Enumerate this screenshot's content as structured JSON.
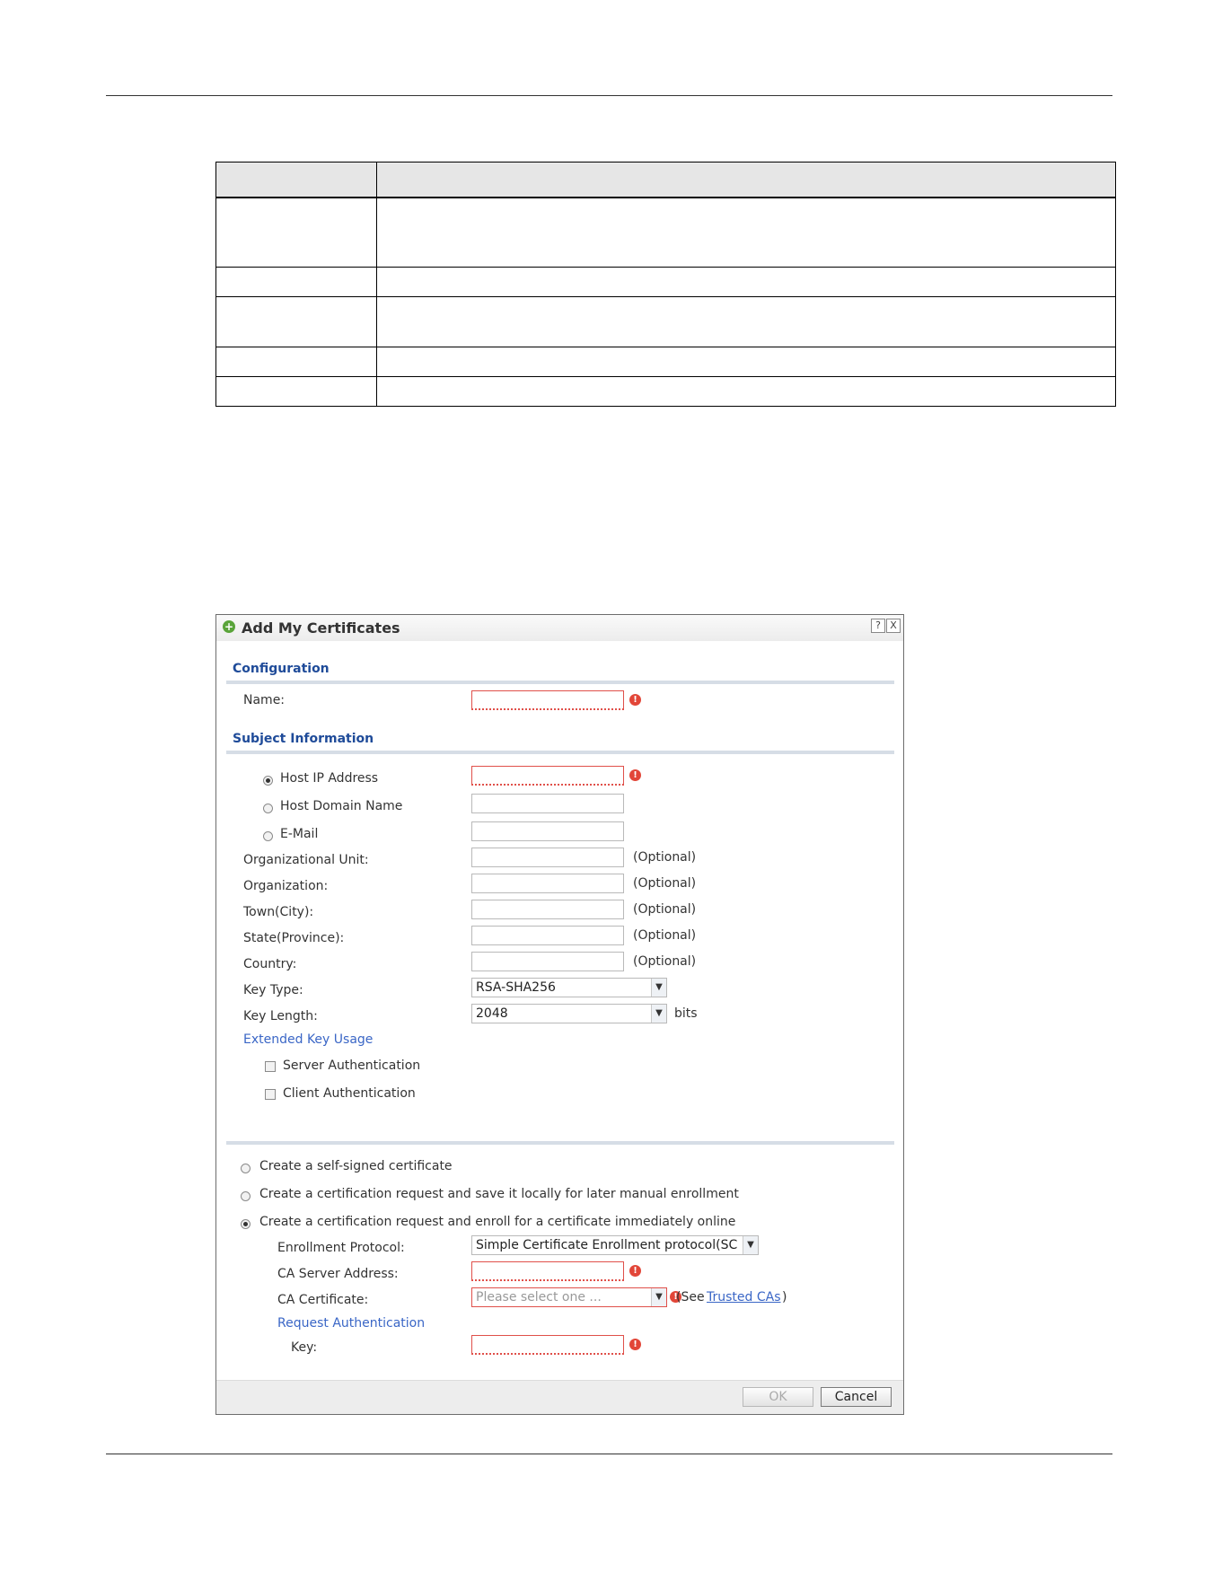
{
  "dialog": {
    "title": "Add My Certificates",
    "help_label": "?",
    "close_label": "X",
    "configuration": {
      "section_title": "Configuration",
      "name_label": "Name:"
    },
    "subject": {
      "section_title": "Subject Information",
      "host_ip_label": "Host IP Address",
      "host_domain_label": "Host Domain Name",
      "email_label": "E-Mail",
      "org_unit_label": "Organizational Unit:",
      "organization_label": "Organization:",
      "town_label": "Town(City):",
      "state_label": "State(Province):",
      "country_label": "Country:",
      "optional_label": "(Optional)",
      "key_type_label": "Key Type:",
      "key_type_value": "RSA-SHA256",
      "key_length_label": "Key Length:",
      "key_length_value": "2048",
      "bits_label": "bits",
      "eku_label": "Extended Key Usage",
      "server_auth_label": "Server Authentication",
      "client_auth_label": "Client Authentication"
    },
    "generation": {
      "self_signed_label": "Create a self-signed certificate",
      "request_save_label": "Create a certification request and save it locally for later manual enrollment",
      "request_enroll_label": "Create a certification request and enroll for a certificate immediately online",
      "enrollment_protocol_label": "Enrollment Protocol:",
      "enrollment_protocol_value": "Simple Certificate Enrollment protocol(SC",
      "ca_server_label": "CA Server Address:",
      "ca_cert_label": "CA Certificate:",
      "ca_cert_placeholder": "Please select one ...",
      "see_label": "(See",
      "trusted_cas_label": "Trusted CAs",
      "close_paren": ")",
      "request_auth_label": "Request Authentication",
      "key_label": "Key:"
    },
    "buttons": {
      "ok_label": "OK",
      "cancel_label": "Cancel"
    }
  }
}
